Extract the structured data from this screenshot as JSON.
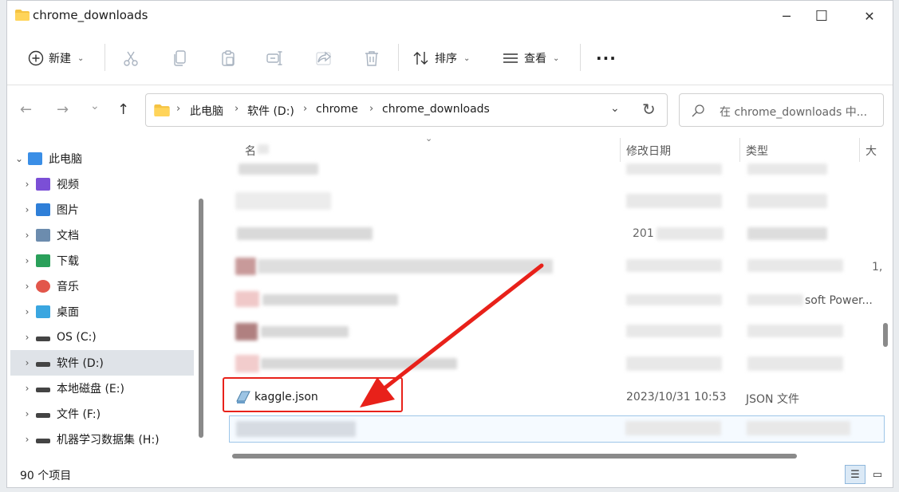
{
  "window": {
    "title": "chrome_downloads",
    "controls": {
      "minimize": "─",
      "maximize": "☐",
      "close": "✕"
    }
  },
  "toolbar": {
    "new_label": "新建",
    "sort_label": "排序",
    "view_label": "查看",
    "more_label": "···",
    "icons": [
      "cut-icon",
      "copy-icon",
      "paste-icon",
      "rename-icon",
      "share-icon",
      "delete-icon"
    ]
  },
  "nav": {
    "back": "←",
    "forward": "→",
    "recent": "⌄",
    "up": "↑",
    "refresh": "↻"
  },
  "address": {
    "parts": [
      "此电脑",
      "软件 (D:)",
      "chrome",
      "chrome_downloads"
    ],
    "separator": "›"
  },
  "search": {
    "placeholder": "在 chrome_downloads 中..."
  },
  "sidebar": {
    "items": [
      {
        "label": "此电脑",
        "icon": "computer-icon",
        "color": "#3a8ee6"
      },
      {
        "label": "视频",
        "icon": "video-icon",
        "color": "#7b4fd6"
      },
      {
        "label": "图片",
        "icon": "pictures-icon",
        "color": "#2f7fd8"
      },
      {
        "label": "文档",
        "icon": "documents-icon",
        "color": "#6c8cae"
      },
      {
        "label": "下载",
        "icon": "download-icon",
        "color": "#2aa05a"
      },
      {
        "label": "音乐",
        "icon": "music-icon",
        "color": "#e2564b"
      },
      {
        "label": "桌面",
        "icon": "desktop-icon",
        "color": "#3aa6e0"
      },
      {
        "label": "OS (C:)",
        "icon": "drive-c-icon",
        "color": "#444444"
      },
      {
        "label": "软件 (D:)",
        "icon": "drive-icon",
        "color": "#444444"
      },
      {
        "label": "本地磁盘 (E:)",
        "icon": "drive-icon",
        "color": "#444444"
      },
      {
        "label": "文件 (F:)",
        "icon": "drive-icon",
        "color": "#444444"
      },
      {
        "label": "机器学习数据集 (H:)",
        "icon": "drive-icon",
        "color": "#444444"
      }
    ]
  },
  "columns": {
    "name": "名",
    "modified": "修改日期",
    "type": "类型",
    "size": "大"
  },
  "files": {
    "highlighted": {
      "name": "kaggle.json",
      "modified": "2023/10/31 10:53",
      "type": "JSON 文件"
    },
    "partial_visible": {
      "date_fragment": "201",
      "type_fragment": "soft Power...",
      "size_fragment": "1,"
    }
  },
  "status": {
    "count": "90 个项目"
  },
  "annotation": {
    "color": "#e8211a"
  }
}
